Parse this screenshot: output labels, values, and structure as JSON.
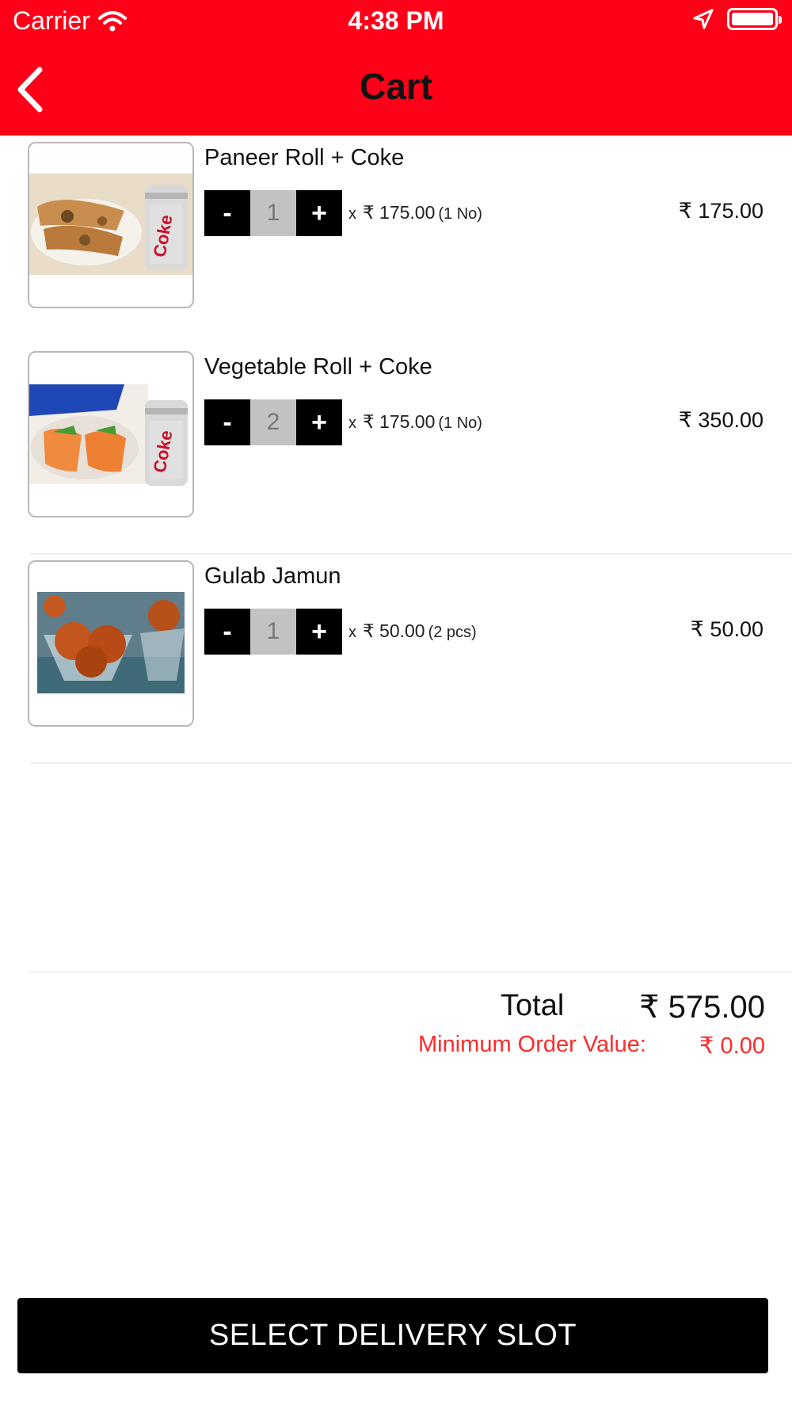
{
  "status_bar": {
    "carrier": "Carrier",
    "time": "4:38 PM",
    "icons": [
      "wifi-icon",
      "location-arrow-icon",
      "battery-icon"
    ]
  },
  "nav": {
    "title": "Cart",
    "back_icon": "chevron-left-icon"
  },
  "theme": {
    "accent": "#ff0019",
    "button": "#000000",
    "warning_text": "#ff2a2a"
  },
  "cart": {
    "items": [
      {
        "name": "Paneer Roll + Coke",
        "decrement": "-",
        "quantity": "1",
        "increment": "+",
        "multiplier": "x",
        "unit_price": "₹ 175.00",
        "unit_size": "(1 No)",
        "line_total": "₹ 175.00",
        "image": "paneer-roll-with-diet-coke-image"
      },
      {
        "name": "Vegetable Roll + Coke",
        "decrement": "-",
        "quantity": "2",
        "increment": "+",
        "multiplier": "x",
        "unit_price": "₹ 175.00",
        "unit_size": "(1 No)",
        "line_total": "₹ 350.00",
        "image": "vegetable-roll-with-diet-coke-image"
      },
      {
        "name": "Gulab Jamun",
        "decrement": "-",
        "quantity": "1",
        "increment": "+",
        "multiplier": "x",
        "unit_price": "₹ 50.00",
        "unit_size": "(2 pcs)",
        "line_total": "₹ 50.00",
        "image": "gulab-jamun-image"
      }
    ]
  },
  "summary": {
    "total_label": "Total",
    "total_value": "₹ 575.00",
    "min_order_label": "Minimum Order Value:",
    "min_order_value": "₹ 0.00"
  },
  "cta": {
    "label": "SELECT DELIVERY SLOT"
  }
}
